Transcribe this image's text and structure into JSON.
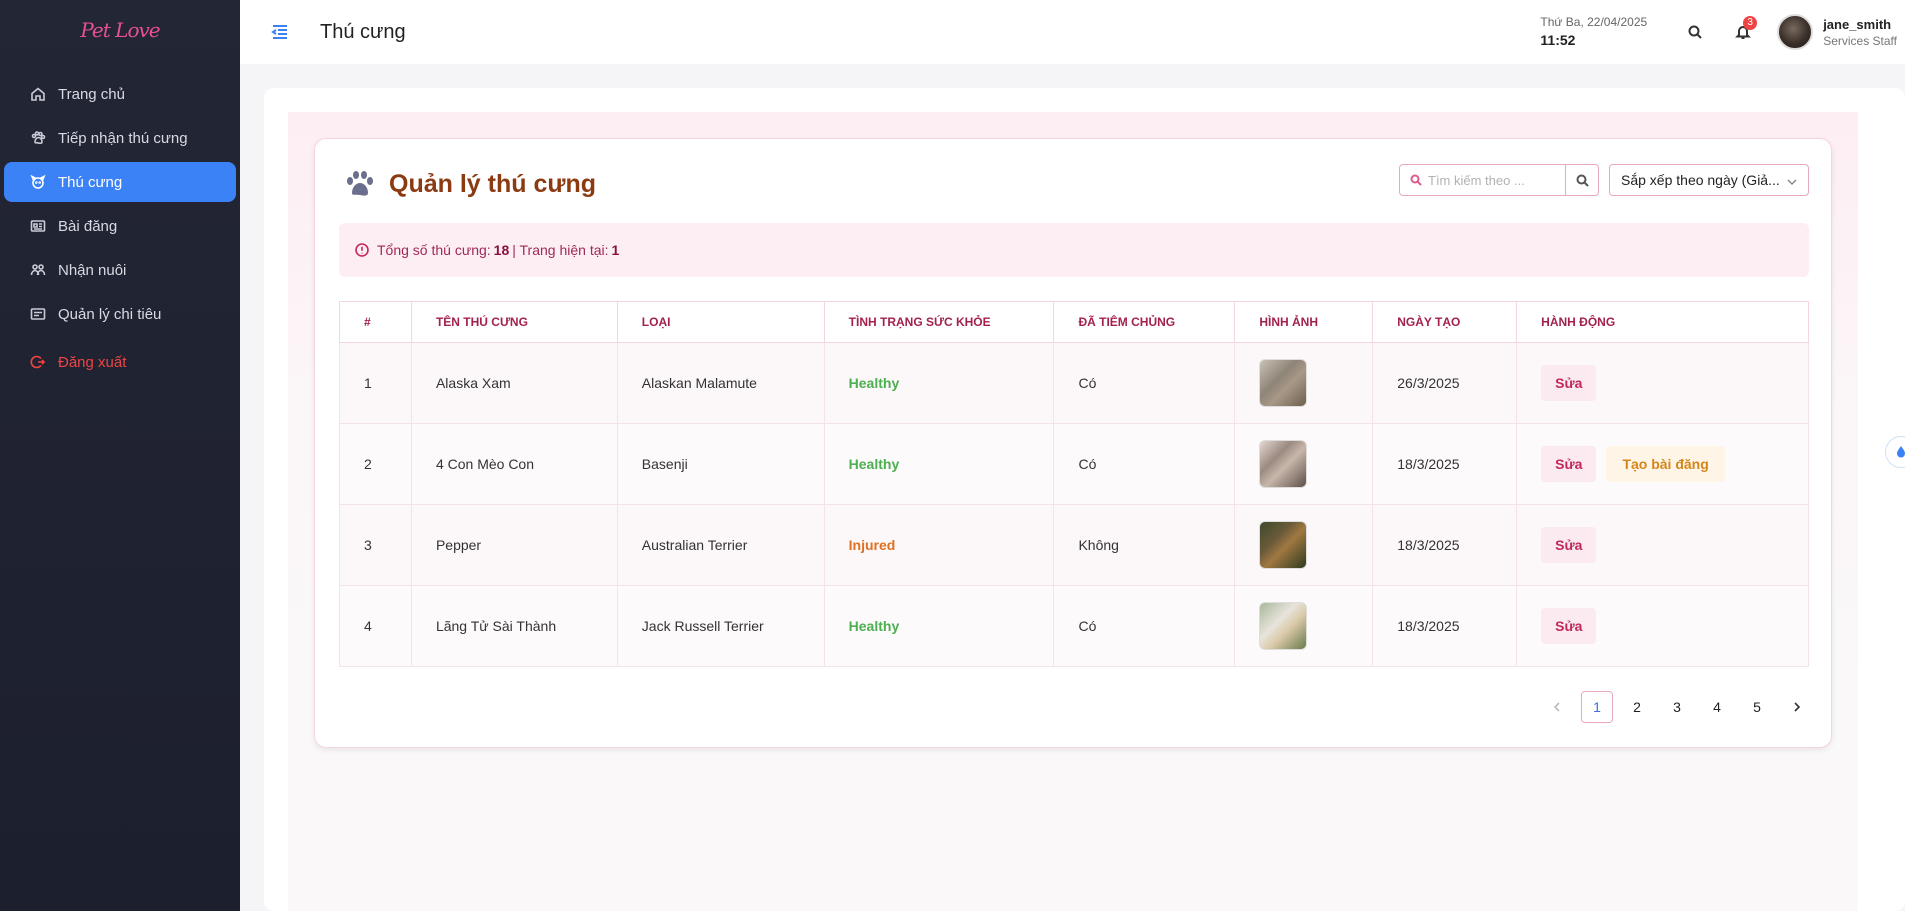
{
  "app": {
    "logo_text": "Pet Love"
  },
  "sidebar": {
    "items": [
      {
        "label": "Trang chủ",
        "icon": "home-icon"
      },
      {
        "label": "Tiếp nhận thú cưng",
        "icon": "paw-icon"
      },
      {
        "label": "Thú cưng",
        "icon": "dog-icon",
        "active": true
      },
      {
        "label": "Bài đăng",
        "icon": "newspaper-icon"
      },
      {
        "label": "Nhận nuôi",
        "icon": "people-icon"
      },
      {
        "label": "Quản lý chi tiêu",
        "icon": "wallet-icon"
      }
    ],
    "logout": "Đăng xuất"
  },
  "header": {
    "title": "Thú cưng",
    "date": "Thứ Ba, 22/04/2025",
    "time": "11:52",
    "notifications": "3",
    "user_name": "jane_smith",
    "user_role": "Services Staff"
  },
  "panel": {
    "title": "Quản lý thú cưng",
    "search_placeholder": "Tìm kiếm theo ...",
    "sort_label": "Sắp xếp theo ngày (Giả...",
    "info_prefix": "Tổng số thú cưng:",
    "total": "18",
    "info_separator": "| Trang hiện tại:",
    "current_page": "1"
  },
  "table": {
    "columns": [
      "#",
      "TÊN THÚ CƯNG",
      "LOẠI",
      "TÌNH TRẠNG SỨC KHỎE",
      "ĐÃ TIÊM CHỦNG",
      "HÌNH ẢNH",
      "NGÀY TẠO",
      "HÀNH ĐỘNG"
    ],
    "edit_label": "Sửa",
    "post_label": "Tạo bài đăng",
    "rows": [
      {
        "no": "1",
        "name": "Alaska Xam",
        "breed": "Alaskan Malamute",
        "health": "Healthy",
        "vaccinated": "Có",
        "created": "26/3/2025"
      },
      {
        "no": "2",
        "name": "4 Con Mèo Con",
        "breed": "Basenji",
        "health": "Healthy",
        "vaccinated": "Có",
        "created": "18/3/2025"
      },
      {
        "no": "3",
        "name": "Pepper",
        "breed": "Australian Terrier",
        "health": "Injured",
        "vaccinated": "Không",
        "created": "18/3/2025"
      },
      {
        "no": "4",
        "name": "Lãng Tử Sài Thành",
        "breed": "Jack Russell Terrier",
        "health": "Healthy",
        "vaccinated": "Có",
        "created": "18/3/2025"
      }
    ]
  },
  "pagination": {
    "pages": [
      "1",
      "2",
      "3",
      "4",
      "5"
    ],
    "active": "1"
  },
  "colors": {
    "accent": "#3b82f6",
    "brand": "#e7518f",
    "healthy": "#4caf50",
    "injured": "#e07020"
  }
}
